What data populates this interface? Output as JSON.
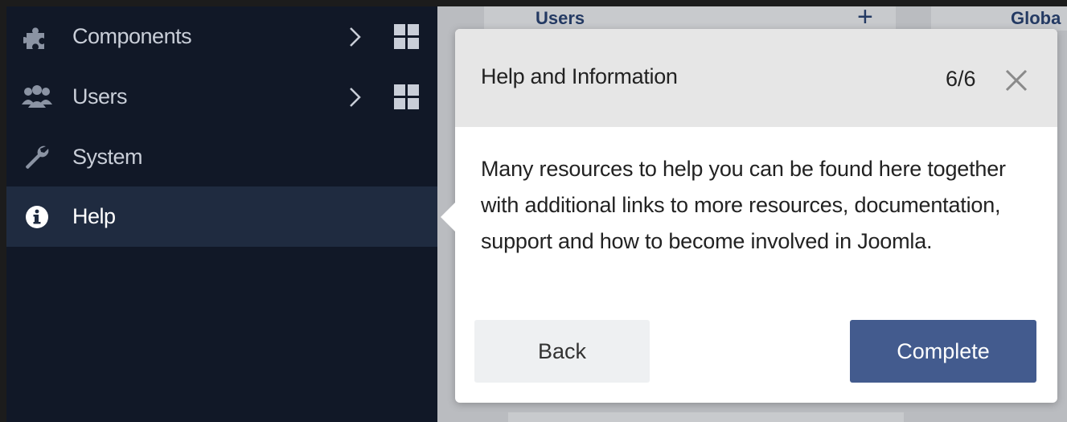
{
  "sidebar": {
    "items": [
      {
        "label": "Components",
        "icon": "puzzle-icon",
        "has_submenu": true,
        "has_dashboard": true,
        "active": false
      },
      {
        "label": "Users",
        "icon": "users-icon",
        "has_submenu": true,
        "has_dashboard": true,
        "active": false
      },
      {
        "label": "System",
        "icon": "wrench-icon",
        "has_submenu": false,
        "has_dashboard": false,
        "active": false
      },
      {
        "label": "Help",
        "icon": "info-icon",
        "has_submenu": false,
        "has_dashboard": false,
        "active": true
      }
    ]
  },
  "background": {
    "users_card_title": "Users",
    "global_card_title": "Globa"
  },
  "tour": {
    "title": "Help and Information",
    "progress": "6/6",
    "body": "Many resources to help you can be found here together with additional links to more resources, documentation, support and how to become involved in Joomla.",
    "back_label": "Back",
    "complete_label": "Complete"
  },
  "colors": {
    "sidebar_bg": "#111827",
    "sidebar_active_bg": "#1f2b40",
    "primary_button": "#435b8e",
    "header_bg": "#e6e6e6"
  }
}
